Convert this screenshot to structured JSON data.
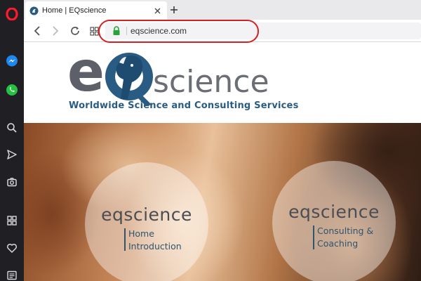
{
  "browser": {
    "tab": {
      "title": "Home | EQscience"
    },
    "address_bar": {
      "url": "eqscience.com"
    },
    "sidebar_icons": [
      "opera-logo-icon",
      "messenger-icon",
      "whatsapp-icon",
      "search-icon",
      "send-icon",
      "camera-icon",
      "grid-icon",
      "heart-icon",
      "news-icon"
    ],
    "toolbar_icons": [
      "back-arrow-icon",
      "forward-arrow-icon",
      "reload-icon",
      "tiles-icon",
      "lock-icon"
    ],
    "highlight_color": "#d42020"
  },
  "page": {
    "logo": {
      "letters": "eQ",
      "wordmark": "science"
    },
    "tagline": "Worldwide Science and Consulting Services",
    "hero": {
      "circles": [
        {
          "brand": "eqscience",
          "lines": [
            "Home",
            "Introduction"
          ]
        },
        {
          "brand": "eqscience",
          "lines": [
            "Consulting &",
            "Coaching"
          ]
        }
      ]
    },
    "colors": {
      "brand_blue": "#2a5c83",
      "brand_gray": "#6b6e75"
    }
  }
}
